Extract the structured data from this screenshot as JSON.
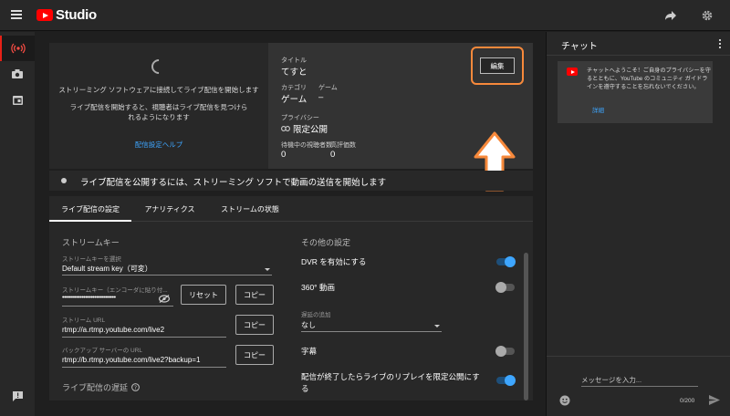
{
  "app": {
    "logo_text": "Studio"
  },
  "preview": {
    "message1": "ストリーミング ソフトウェアに接続してライブ配信を開始します",
    "message2": "ライブ配信を開始すると、視聴者はライブ配信を見つけられるようになります",
    "help_link": "配信設定ヘルプ"
  },
  "info": {
    "title_label": "タイトル",
    "title_value": "てすと",
    "category_label": "カテゴリ",
    "category_value": "ゲーム",
    "game_label": "ゲーム",
    "game_value": "–",
    "privacy_label": "プライバシー",
    "privacy_value": "限定公開",
    "waiting_label": "待機中の視聴者数",
    "waiting_value": "0",
    "likes_label": "高評価数",
    "likes_value": "0",
    "edit_label": "編集"
  },
  "status": {
    "message": "ライブ配信を公開するには、ストリーミング ソフトで動画の送信を開始します"
  },
  "tabs": [
    {
      "label": "ライブ配信の設定",
      "active": true
    },
    {
      "label": "アナリティクス",
      "active": false
    },
    {
      "label": "ストリームの状態",
      "active": false
    }
  ],
  "stream_key": {
    "section_title": "ストリームキー",
    "select_label": "ストリームキーを選択",
    "select_value": "Default stream key（可変）",
    "key_label": "ストリームキー（エンコーダに貼り付...",
    "key_value": "••••••••••••••••••••••••••••••",
    "reset_label": "リセット",
    "copy_label": "コピー",
    "url_label": "ストリーム URL",
    "url_value": "rtmp://a.rtmp.youtube.com/live2",
    "backup_label": "バックアップ サーバーの URL",
    "backup_value": "rtmp://b.rtmp.youtube.com/live2?backup=1",
    "latency_section": "ライブ配信の遅延"
  },
  "other_settings": {
    "section_title": "その他の設定",
    "dvr_label": "DVR を有効にする",
    "dvr_on": true,
    "vr360_label": "360° 動画",
    "vr360_on": false,
    "delay_label": "遅延の追加",
    "delay_value": "なし",
    "captions_label": "字幕",
    "captions_on": false,
    "replay_label": "配信が終了したらライブのリプレイを限定公開にする",
    "replay_on": true
  },
  "chat": {
    "title": "チャット",
    "welcome_message": "チャットへようこそ！ご自身のプライバシーを守るとともに、YouTube のコミュニティ ガイドラインを遵守することを忘れないでください。",
    "details_link": "詳細",
    "input_placeholder": "メッセージを入力...",
    "char_count": "0/200"
  },
  "colors": {
    "accent_blue": "#3ea6ff",
    "annotation_orange": "#f7893b",
    "brand_red": "#ff0000"
  }
}
